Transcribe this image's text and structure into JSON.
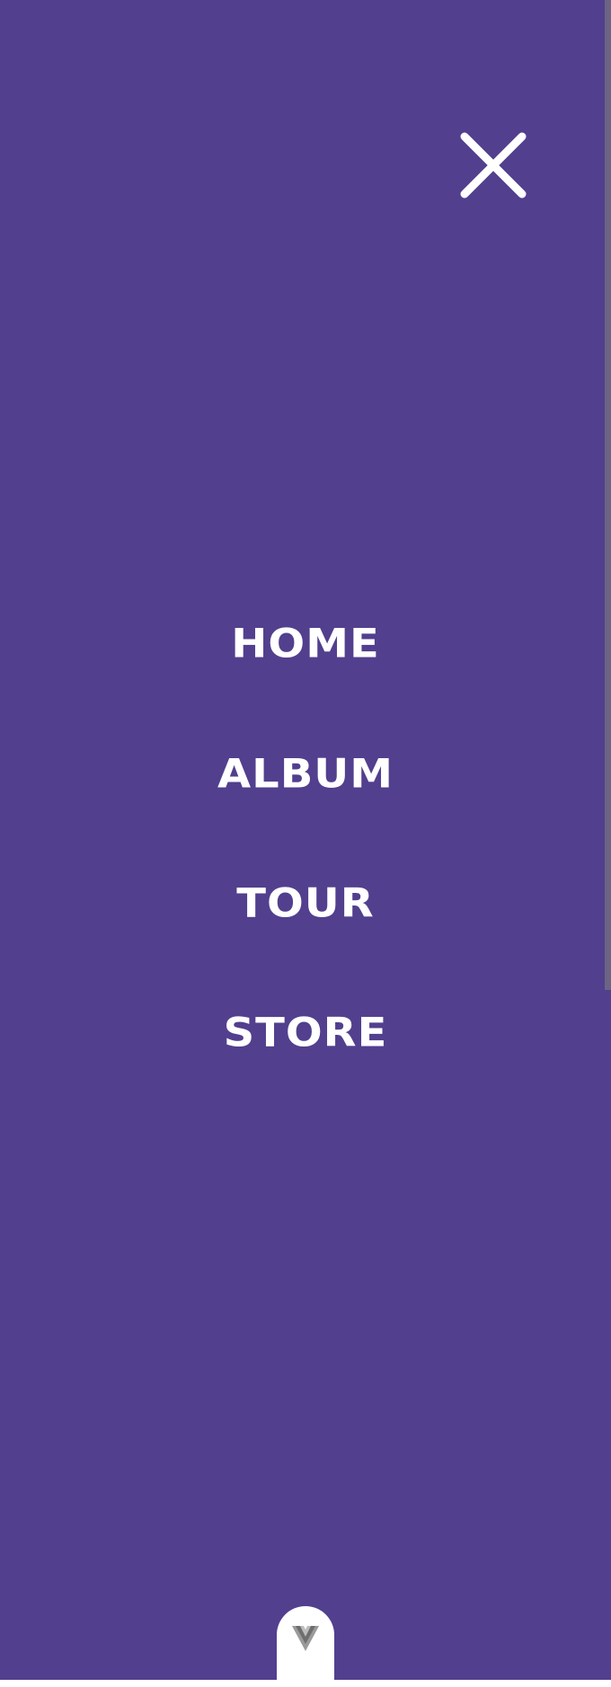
{
  "menu": {
    "background_color": "#523f8e",
    "text_color": "#ffffff",
    "close_icon": "close-icon",
    "items": [
      {
        "label": "HOME"
      },
      {
        "label": "ALBUM"
      },
      {
        "label": "TOUR"
      },
      {
        "label": "STORE"
      }
    ]
  },
  "footer": {
    "logo_icon": "v-logo-icon"
  }
}
